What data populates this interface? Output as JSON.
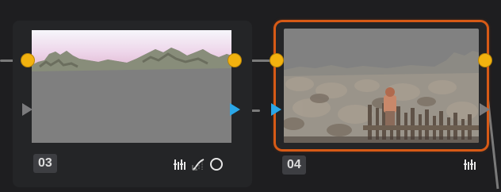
{
  "colors": {
    "background": "#1e1e20",
    "node_body": "#242527",
    "selected_outline": "#d75a16",
    "rgb_port": "#f2b20f",
    "key_port_gray": "#7b7b7d",
    "key_port_blue": "#2aa7e8",
    "label_bg": "#3d3e42",
    "label_text": "#dcdcdc"
  },
  "nodes": [
    {
      "label": "03",
      "selected": false,
      "tool_icons": [
        "color-wheels-icon",
        "curves-icon",
        "power-window-circle-icon"
      ]
    },
    {
      "label": "04",
      "selected": true,
      "tool_icons": [
        "color-wheels-icon"
      ]
    }
  ]
}
